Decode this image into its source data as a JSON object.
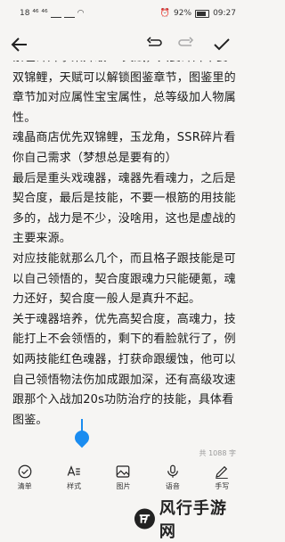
{
  "status_bar": {
    "left_indicators": "18 ⁴⁶ ⁴⁶",
    "battery": "92%",
    "time": "09:27"
  },
  "toolbar": {
    "back_icon": "arrow-left-icon",
    "undo_icon": "undo-icon",
    "redo_icon": "redo-icon",
    "done_icon": "check-icon"
  },
  "note": {
    "paragraphs": [
      "紧色碎片事某升级SR关赋，只要碎片不要双锦鲤，天赋可以解锁图鉴章节，图鉴里的章节加对应属性宝宝属性，总等级加人物属性。",
      "魂晶商店优先双锦鲤，玉龙角，SSR碎片看你自己需求（梦想总是要有的）",
      "        最后是重头戏魂器，魂器先看魂力，之后是契合度，最后是技能，不要一根筋的用技能多的，战力是不少，没啥用，这也是虚战的主要来源。",
      "        对应技能就那么几个，而且格子跟技能是可以自己领悟的，契合度跟魂力只能硬氪，魂力还好，契合度一般人是真升不起。",
      "        关于魂器培养，优先高契合度，高魂力，技能打上不会领悟的，剩下的看脸就行了，例如两技能红色魂器，打获命跟缓蚀，他可以自己领悟物法伤加成跟加深，还有高级攻速跟那个入战加20s功防治疗的技能，具体看图鉴。"
    ],
    "word_count": "共 1088 字"
  },
  "bottom_bar": {
    "items": [
      {
        "label": "清单",
        "icon": "checklist-icon"
      },
      {
        "label": "样式",
        "icon": "text-style-icon"
      },
      {
        "label": "图片",
        "icon": "image-icon"
      },
      {
        "label": "语音",
        "icon": "microphone-icon"
      },
      {
        "label": "手写",
        "icon": "handwriting-icon"
      }
    ]
  },
  "watermark": {
    "text": "风行手游网"
  }
}
